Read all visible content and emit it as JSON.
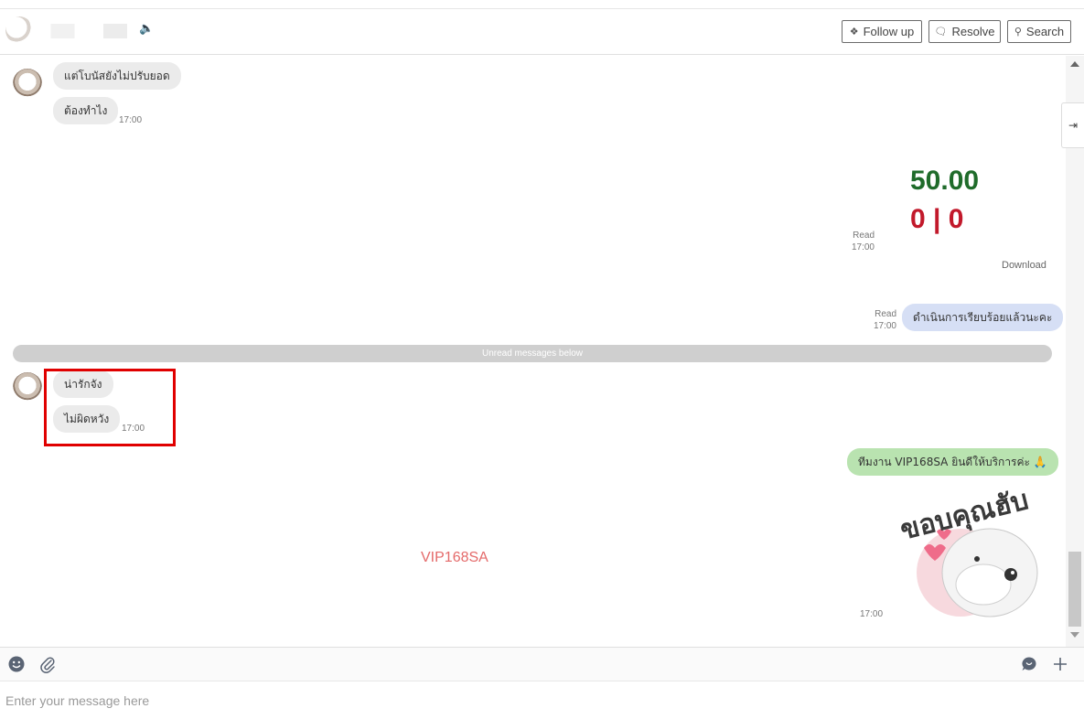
{
  "header": {
    "contact_name": "",
    "buttons": {
      "follow_up": "Follow up",
      "resolve": "Resolve",
      "search": "Search"
    }
  },
  "messages": {
    "m1": {
      "text": "แต่โบนัสยังไม่ปรับยอด"
    },
    "m2": {
      "text": "ต้องทำไง",
      "time": "17:00"
    },
    "image": {
      "value1": "50.00",
      "value2": "0 | 0",
      "status": "Read",
      "time": "17:00",
      "download": "Download"
    },
    "m3": {
      "text": "ดำเนินการเรียบร้อยแล้วนะคะ",
      "status": "Read",
      "time": "17:00"
    },
    "divider": "Unread messages below",
    "m4": {
      "text": "น่ารักจัง"
    },
    "m5": {
      "text": "ไม่ผิดหวัง",
      "time": "17:00"
    },
    "m6": {
      "text": "ทีมงาน VIP168SA ยินดีให้บริการค่ะ 🙏"
    },
    "sticker": {
      "caption": "ขอบคุณฮับ",
      "time": "17:00"
    }
  },
  "watermark": "VIP168SA",
  "composer": {
    "placeholder": "Enter your message here"
  },
  "colors": {
    "incoming_bubble": "#ebebeb",
    "outgoing_bubble_blue": "#d6dff5",
    "outgoing_bubble_green": "#b9e3b0",
    "highlight_border": "#e00000",
    "watermark": "#e46a6a"
  }
}
